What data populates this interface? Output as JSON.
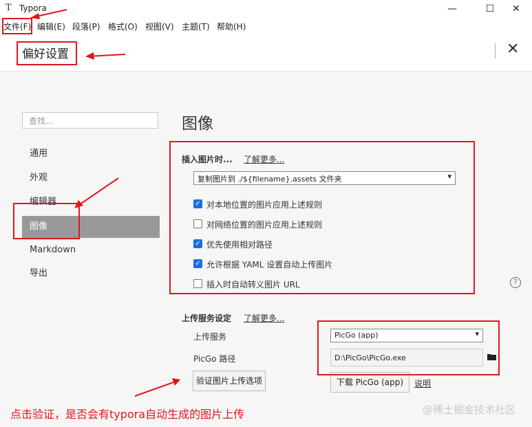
{
  "window": {
    "app_icon": "T",
    "title": "Typora",
    "minimize_icon": "—",
    "maximize_icon": "☐",
    "close_icon": "✕"
  },
  "menu": [
    {
      "label": "文件(F)"
    },
    {
      "label": "编辑(E)"
    },
    {
      "label": "段落(P)"
    },
    {
      "label": "格式(O)"
    },
    {
      "label": "视图(V)"
    },
    {
      "label": "主题(T)"
    },
    {
      "label": "帮助(H)"
    }
  ],
  "header": {
    "title": "偏好设置",
    "close_icon": "✕"
  },
  "sidebar": {
    "search_placeholder": "查找...",
    "items": [
      {
        "label": "通用"
      },
      {
        "label": "外观"
      },
      {
        "label": "编辑器"
      },
      {
        "label": "图像",
        "active": true
      },
      {
        "label": "Markdown"
      },
      {
        "label": "导出"
      }
    ]
  },
  "main": {
    "title": "图像",
    "insert": {
      "label": "插入图片时...",
      "learn_more": "了解更多...",
      "dropdown_value": "复制图片到 ./${filename}.assets 文件夹",
      "checkboxes": [
        {
          "label": "对本地位置的图片应用上述规则",
          "checked": true
        },
        {
          "label": "对网络位置的图片应用上述规则",
          "checked": false
        },
        {
          "label": "优先使用相对路径",
          "checked": true
        },
        {
          "label": "允许根据 YAML 设置自动上传图片",
          "checked": true
        },
        {
          "label": "插入时自动转义图片 URL",
          "checked": false
        }
      ]
    },
    "upload": {
      "label": "上传服务设定",
      "learn_more": "了解更多...",
      "service_label": "上传服务",
      "service_value": "PicGo (app)",
      "path_label": "PicGo 路径",
      "path_value": "D:\\PicGo\\PicGo.exe",
      "verify_button": "验证图片上传选项",
      "download_button": "下载 PicGo (app)",
      "explain_link": "说明"
    },
    "help_icon": "?"
  },
  "annotation": {
    "text": "点击验证，是否会有typora自动生成的图片上传",
    "color": "#e0161c"
  },
  "watermark": "@稀土掘金技术社区",
  "colors": {
    "accent": "#1a6fe0",
    "active_nav": "#999999",
    "annotation": "#e0161c"
  }
}
